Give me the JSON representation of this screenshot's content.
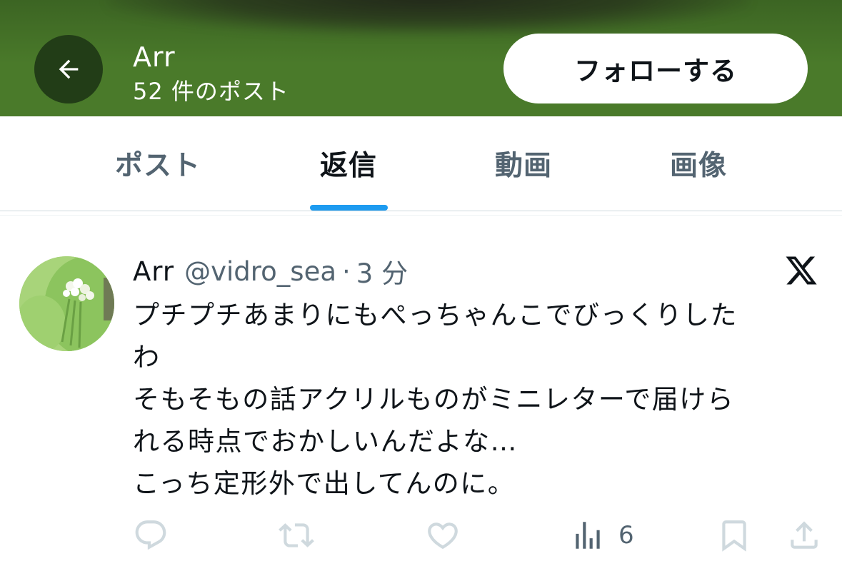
{
  "header": {
    "name": "Arr",
    "post_count": "52 件のポスト",
    "follow_label": "フォローする",
    "back_icon": "arrow-left-icon",
    "colors": {
      "background": "#4a7a2a",
      "back_button": "#223d17"
    }
  },
  "tabs": [
    {
      "label": "ポスト",
      "active": false
    },
    {
      "label": "返信",
      "active": true
    },
    {
      "label": "動画",
      "active": false
    },
    {
      "label": "画像",
      "active": false
    }
  ],
  "accent_color": "#1d9bf0",
  "post": {
    "display_name": "Arr",
    "handle": "@vidro_sea",
    "separator": "·",
    "time": "3 分",
    "brand_icon": "x-logo-icon",
    "lines": [
      "プチプチあまりにもぺっちゃんこでびっくりした",
      "わ",
      "そもそもの話アクリルものがミニレターで届けら",
      "れる時点でおかしいんだよな…",
      "こっち定形外で出してんのに。"
    ],
    "actions": {
      "reply_icon": "reply-icon",
      "repost_icon": "repost-icon",
      "like_icon": "heart-icon",
      "views_icon": "views-icon",
      "views_count": "6",
      "bookmark_icon": "bookmark-icon",
      "share_icon": "share-icon"
    }
  }
}
